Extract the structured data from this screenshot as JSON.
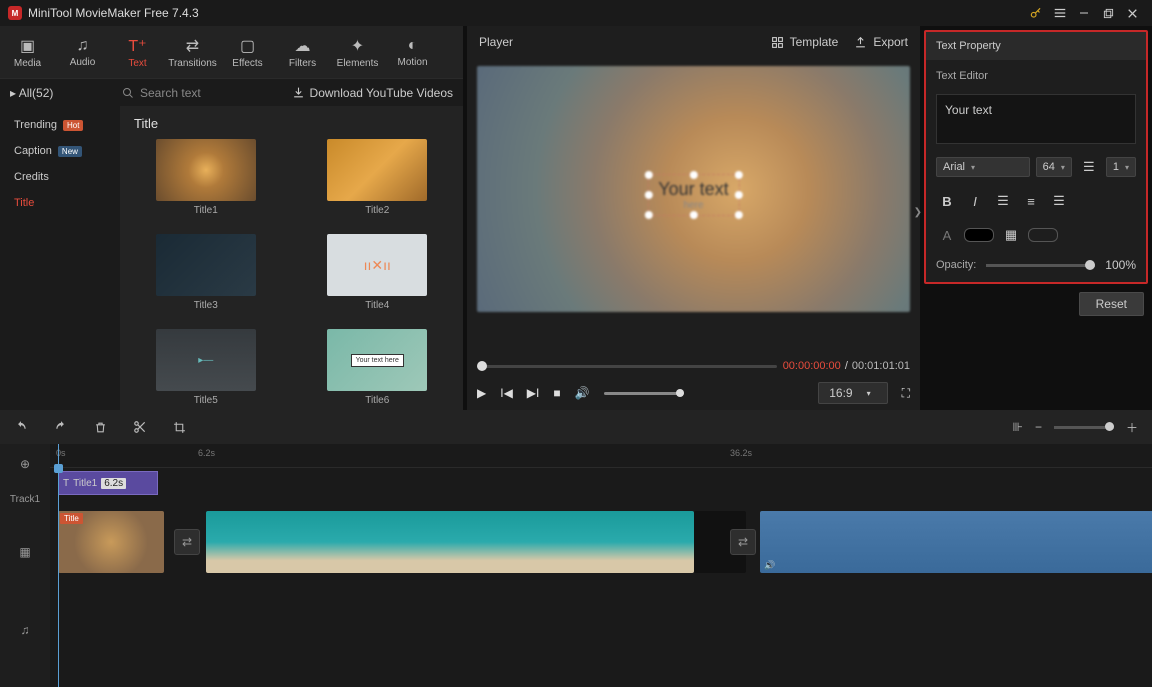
{
  "titlebar": {
    "app": "MiniTool MovieMaker Free 7.4.3"
  },
  "toolbar": {
    "media": "Media",
    "audio": "Audio",
    "text": "Text",
    "transitions": "Transitions",
    "effects": "Effects",
    "filters": "Filters",
    "elements": "Elements",
    "motion": "Motion"
  },
  "subbar": {
    "all": "All(52)",
    "search_placeholder": "Search text",
    "download": "Download YouTube Videos"
  },
  "sidebar": {
    "trending": "Trending",
    "caption": "Caption",
    "credits": "Credits",
    "title": "Title",
    "hot": "Hot",
    "new": "New"
  },
  "gallery": {
    "heading": "Title",
    "items": [
      "Title1",
      "Title2",
      "Title3",
      "Title4",
      "Title5",
      "Title6"
    ],
    "t6_sub": "Your text here"
  },
  "player": {
    "title": "Player",
    "template": "Template",
    "export": "Export",
    "text_main": "Your text",
    "text_sub": "here",
    "cur_time": "00:00:00:00",
    "sep": " / ",
    "tot_time": "00:01:01:01",
    "aspect": "16:9"
  },
  "props": {
    "title": "Text Property",
    "editor": "Text Editor",
    "text_value": "Your text",
    "font": "Arial",
    "size": "64",
    "line": "1",
    "opacity_label": "Opacity:",
    "opacity_val": "100%",
    "reset": "Reset"
  },
  "timeline": {
    "ruler": {
      "t0": "0s",
      "t1": "6.2s",
      "t2": "36.2s"
    },
    "track1": "Track1",
    "clip_label": "Title1",
    "clip_dur": "6.2s",
    "vtag": "Title"
  }
}
